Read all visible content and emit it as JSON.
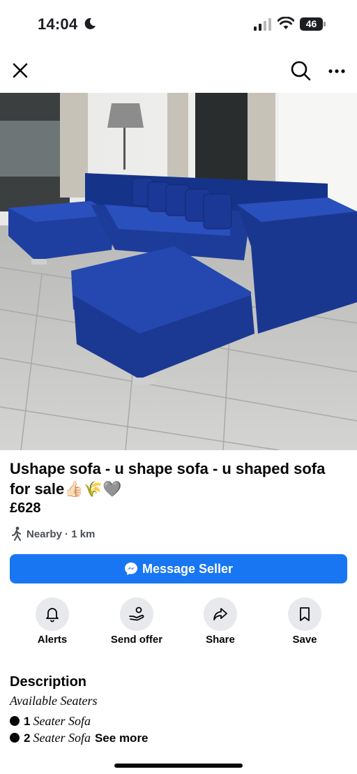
{
  "status_bar": {
    "time": "14:04",
    "battery": "46"
  },
  "listing": {
    "title": "Ushape sofa - u shape sofa - u shaped sofa for sale👍🏻🌾🩶",
    "price": "£628",
    "location": "Nearby · 1 km"
  },
  "message_button": {
    "label": "Message Seller"
  },
  "actions": [
    {
      "label": "Alerts",
      "icon": "bell-icon"
    },
    {
      "label": "Send offer",
      "icon": "offer-icon"
    },
    {
      "label": "Share",
      "icon": "share-icon"
    },
    {
      "label": "Save",
      "icon": "bookmark-icon"
    }
  ],
  "description": {
    "heading": "Description",
    "line1": "Available Seaters",
    "item1_num": "1",
    "item1_text": "Seater Sofa",
    "item2_num": "2",
    "item2_text": "Seater Sofa",
    "see_more": "See more"
  },
  "colors": {
    "accent": "#1876f2",
    "sofa": "#1f3fa0"
  }
}
